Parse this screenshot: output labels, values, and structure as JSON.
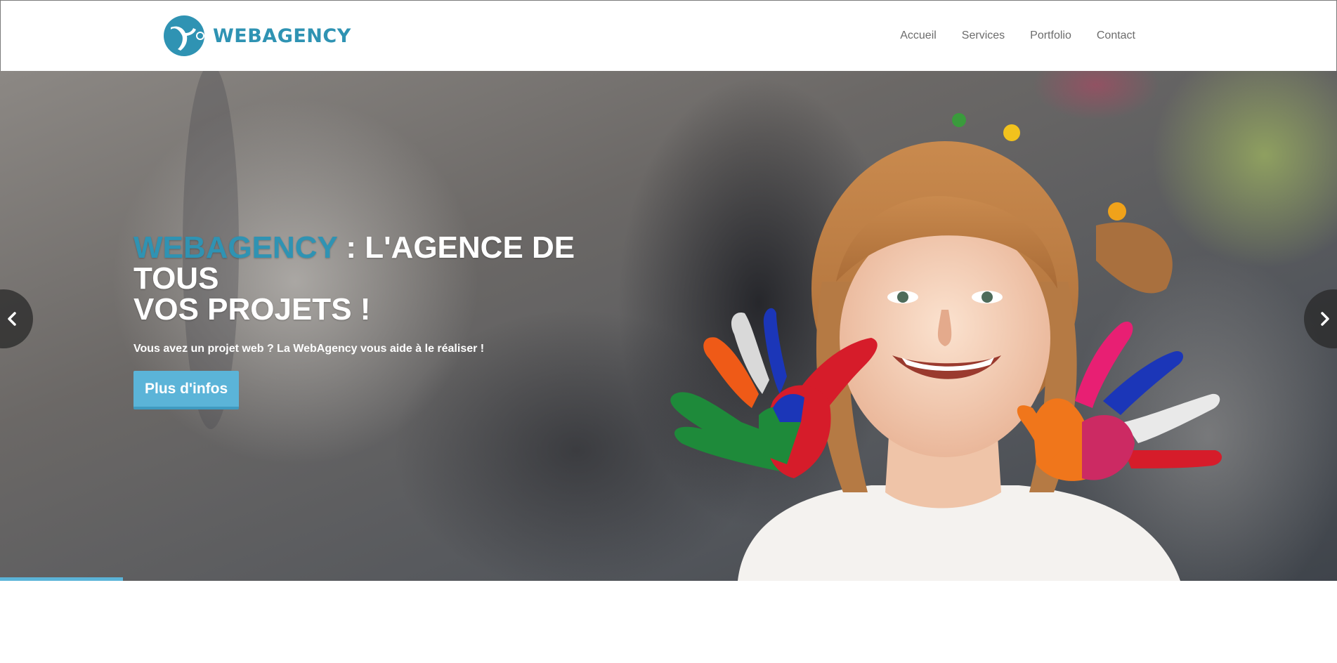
{
  "header": {
    "logo_text": "WEBAGENCY",
    "brand_color": "#2f93b3",
    "nav": [
      {
        "label": "Accueil"
      },
      {
        "label": "Services"
      },
      {
        "label": "Portfolio"
      },
      {
        "label": "Contact"
      }
    ]
  },
  "hero": {
    "title_brand": "WEBAGENCY",
    "title_rest_line1": " : L'AGENCE DE TOUS",
    "title_line2": "VOS PROJETS !",
    "subtitle": "Vous avez un projet web ? La WebAgency vous aide à le réaliser !",
    "button_label": "Plus d'infos",
    "button_color": "#5bb4d8",
    "prev_icon": "chevron-left-icon",
    "next_icon": "chevron-right-icon",
    "slide_progress": 0.092,
    "image_subject": "smiling girl with paint-covered hands"
  }
}
